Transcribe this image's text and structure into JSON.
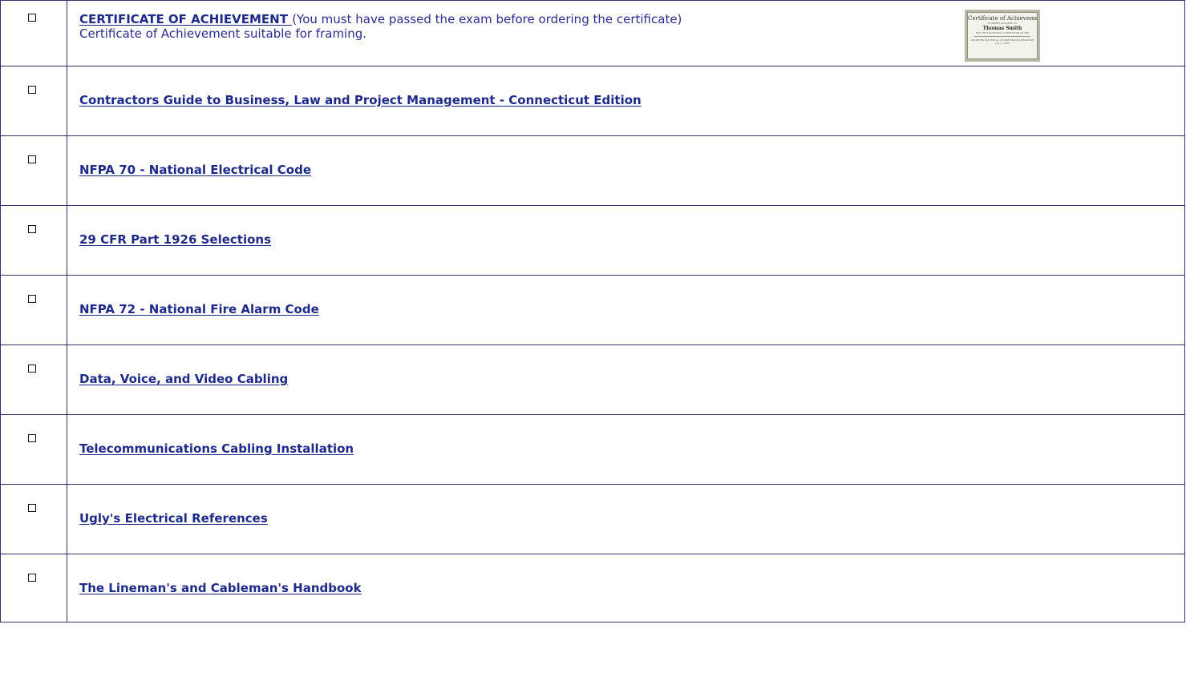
{
  "products": [
    {
      "link_text": "CERTIFICATE OF ACHIEVEMENT ",
      "note": "(You must have passed the exam before ordering the certificate)",
      "description": "Certificate of Achievement suitable for framing.",
      "thumbnail": {
        "title": "Certificate of Achievement",
        "line_1": "IS HEREBY AWARDED TO",
        "name": "Thomas Smith",
        "line_2": "FOR THE SUCCESSFUL COMPLETION OF THE",
        "line_3": "UNLIMITED ELECTRICAL JOURNEYMAN EXAMINATION",
        "line_4": "July 1, 2005"
      }
    },
    {
      "link_text": "Contractors Guide to Business, Law and Project Management - Connecticut Edition"
    },
    {
      "link_text": "NFPA 70 - National Electrical Code"
    },
    {
      "link_text": "29 CFR Part 1926 Selections"
    },
    {
      "link_text": "NFPA 72 - National Fire Alarm Code"
    },
    {
      "link_text": "Data, Voice, and Video Cabling"
    },
    {
      "link_text": "Telecommunications Cabling Installation"
    },
    {
      "link_text": "Ugly's Electrical References"
    },
    {
      "link_text": "The Lineman's and Cableman's Handbook"
    }
  ],
  "colors": {
    "link": "#1f2a88",
    "border": "#34346b"
  },
  "icons": {
    "checkbox": "checkbox-icon"
  }
}
